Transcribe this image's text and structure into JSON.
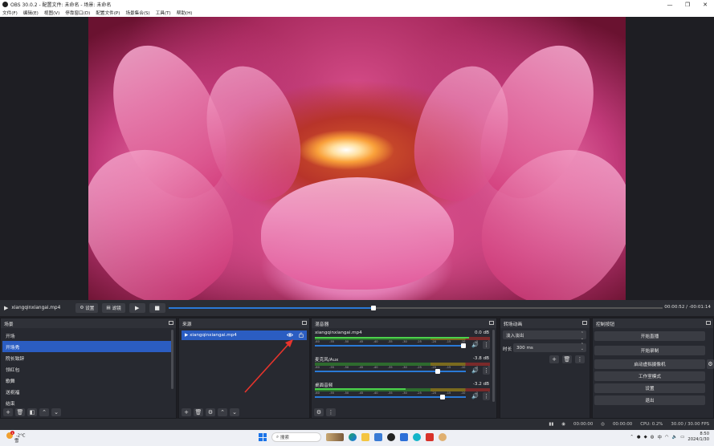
{
  "window": {
    "title": "OBS 30.0.2 - 配置文件: 未命名 - 场景: 未命名",
    "controls": [
      "—",
      "❐",
      "✕"
    ]
  },
  "menu": [
    "文件(F)",
    "编辑(E)",
    "视图(V)",
    "停靠窗口(D)",
    "配置文件(P)",
    "场景集合(S)",
    "工具(T)",
    "帮助(H)"
  ],
  "playback": {
    "media_name": "xiangqinxiangai.mp4",
    "settings_label": "设置",
    "filters_label": "滤镜",
    "progress": 0.415,
    "time": "00:00:52  /  -00:01:14"
  },
  "scenes": {
    "title": "场景",
    "items": [
      "开场",
      "开场秀",
      "院长致辞",
      "领红包",
      "歌舞",
      "送祝福",
      "结束"
    ],
    "active_index": 1
  },
  "sources": {
    "title": "来源",
    "items": [
      "xiangqinxiangai.mp4"
    ]
  },
  "mixer": {
    "title": "混音器",
    "channels": [
      {
        "name": "xiangqinxiangai.mp4",
        "db": "0.0 dB",
        "level": 0.88,
        "volume": 1.0
      },
      {
        "name": "麦克风/Aux",
        "db": "-3.8 dB",
        "level": 0.0,
        "volume": 0.83
      },
      {
        "name": "桌面音频",
        "db": "-3.2 dB",
        "level": 0.52,
        "volume": 0.86
      }
    ],
    "scale": [
      "-60",
      "-55",
      "-50",
      "-45",
      "-40",
      "-35",
      "-30",
      "-25",
      "-20",
      "-15",
      "-10",
      "-5",
      "0"
    ]
  },
  "transitions": {
    "title": "转场动画",
    "selected": "淡入淡出",
    "duration_label": "时长",
    "duration_value": "300 ms"
  },
  "controls": {
    "title": "控制按钮",
    "buttons": [
      "开始直播",
      "开始录制",
      "启动虚拟摄像机",
      "工作室模式",
      "设置",
      "退出"
    ]
  },
  "status": {
    "stream_time": "00:00:00",
    "record_time": "00:00:00",
    "cpu": "CPU: 0.2%",
    "fps": "30.00 / 30.00 FPS"
  },
  "taskbar": {
    "weather_temp": "-2°C",
    "weather_desc": "雪",
    "weather_badge": "1",
    "search_placeholder": "搜索",
    "lang": "中",
    "time": "8:50",
    "date": "2024/1/30"
  },
  "colors": {
    "accent": "#2b5dc2",
    "seek": "#2a79d6",
    "annotation_arrow": "#e8342c"
  }
}
